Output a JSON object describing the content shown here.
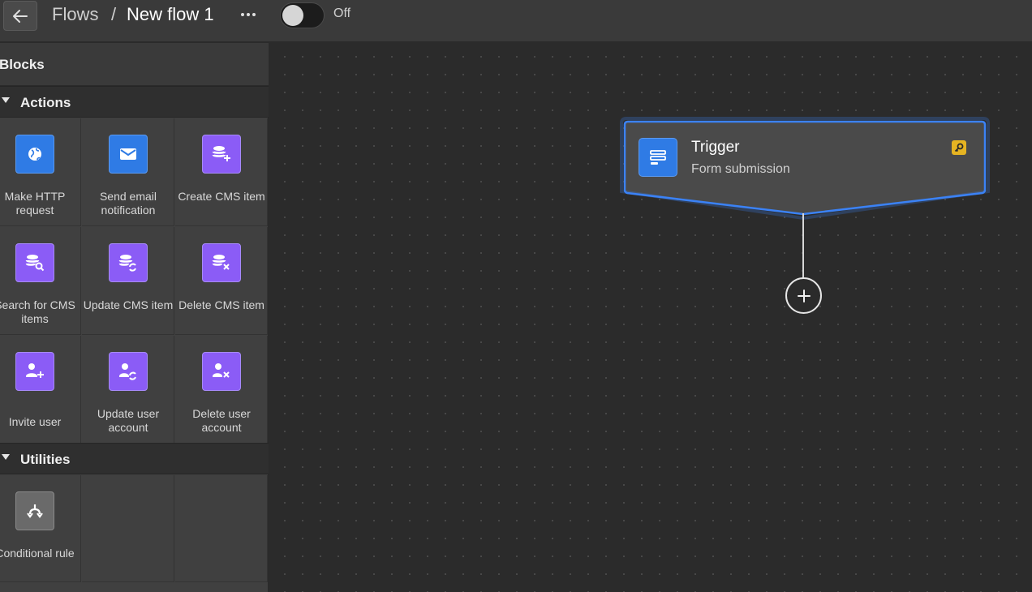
{
  "header": {
    "breadcrumb_parent": "Flows",
    "breadcrumb_separator": "/",
    "flow_name": "New flow 1",
    "more_label": "•••",
    "toggle_state_label": "Off",
    "toggle_on": false
  },
  "sidebar": {
    "title": "Blocks",
    "sections": [
      {
        "label": "Actions",
        "expanded": true,
        "items": [
          {
            "label": "Make HTTP request",
            "icon": "globe-icon",
            "color": "#2f7be5"
          },
          {
            "label": "Send email notification",
            "icon": "envelope-icon",
            "color": "#2f7be5"
          },
          {
            "label": "Create CMS item",
            "icon": "database-plus-icon",
            "color": "#8b5cf6"
          },
          {
            "label": "Search for CMS items",
            "icon": "database-search-icon",
            "color": "#8b5cf6"
          },
          {
            "label": "Update CMS item",
            "icon": "database-refresh-icon",
            "color": "#8b5cf6"
          },
          {
            "label": "Delete CMS item",
            "icon": "database-delete-icon",
            "color": "#8b5cf6"
          },
          {
            "label": "Invite user",
            "icon": "user-plus-icon",
            "color": "#8b5cf6"
          },
          {
            "label": "Update user account",
            "icon": "user-refresh-icon",
            "color": "#8b5cf6"
          },
          {
            "label": "Delete user account",
            "icon": "user-delete-icon",
            "color": "#8b5cf6"
          }
        ]
      },
      {
        "label": "Utilities",
        "expanded": true,
        "items": [
          {
            "label": "Conditional rule",
            "icon": "branch-icon",
            "color": "#6a6a6a"
          }
        ]
      }
    ]
  },
  "canvas": {
    "trigger": {
      "title": "Trigger",
      "subtitle": "Form submission",
      "icon": "form-icon",
      "badge_icon": "key-icon",
      "badge_color": "#e6b422",
      "selected_color": "#3b82f6"
    },
    "add_step_icon": "plus-icon"
  }
}
